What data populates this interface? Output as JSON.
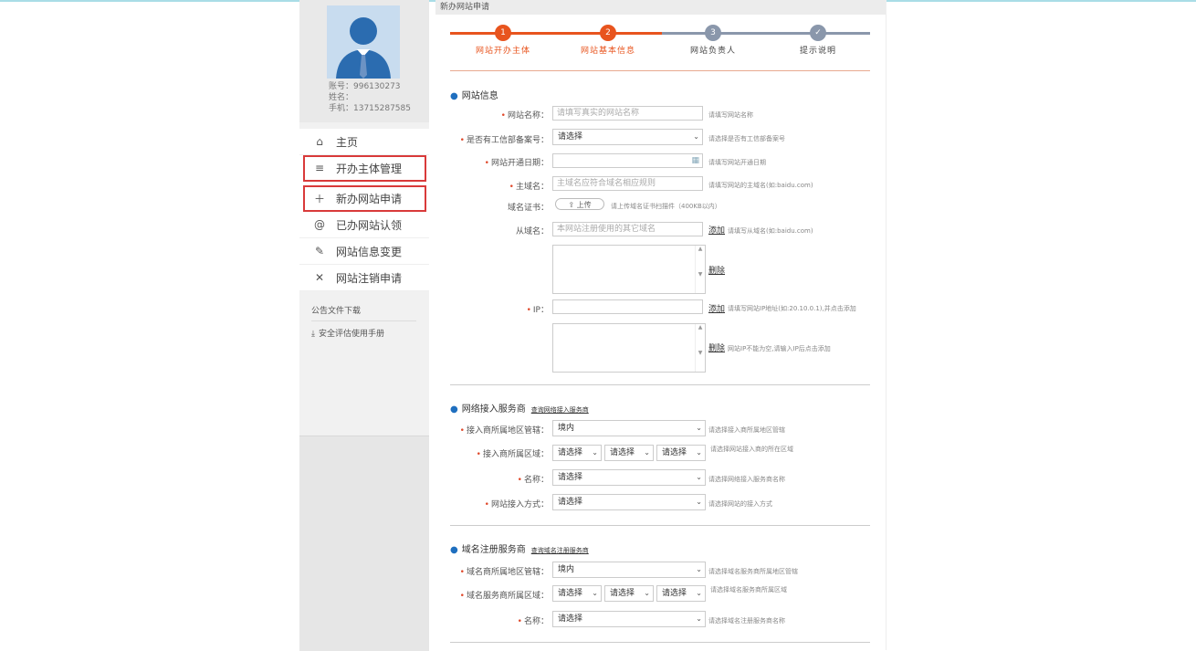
{
  "profile": {
    "account": "账号：996130273",
    "name": "姓名：",
    "phone": "手机：13715287585"
  },
  "menu": [
    {
      "icon": "home-icon",
      "label": "主页"
    },
    {
      "icon": "list-icon",
      "label": "开办主体管理"
    },
    {
      "icon": "plus-icon",
      "label": "新办网站申请"
    },
    {
      "icon": "at-icon",
      "label": "已办网站认领"
    },
    {
      "icon": "edit-icon",
      "label": "网站信息变更"
    },
    {
      "icon": "close-icon",
      "label": "网站注销申请"
    }
  ],
  "downloads": {
    "title": "公告文件下载",
    "item": "安全评估使用手册"
  },
  "breadcrumb": "新办网站申请",
  "steps": [
    {
      "num": "1",
      "label": "网站开办主体"
    },
    {
      "num": "2",
      "label": "网站基本信息"
    },
    {
      "num": "3",
      "label": "网站负责人"
    },
    {
      "num": "✓",
      "label": "提示说明"
    }
  ],
  "colors": {
    "active": "#e8541e",
    "inactive": "#8a97ab",
    "link": "#1f6fbf"
  },
  "site_info": {
    "title": "网站信息",
    "name_label": "网站名称：",
    "name_placeholder": "请填写真实的网站名称",
    "name_hint": "请填写网站名称",
    "icp_label": "是否有工信部备案号：",
    "icp_value": "请选择",
    "icp_hint": "请选择是否有工信部备案号",
    "open_date_label": "网站开通日期：",
    "open_date_hint": "请填写网站开通日期",
    "domain_label": "主域名：",
    "domain_placeholder": "主域名应符合域名相应规则",
    "domain_hint": "请填写网站的主域名(如:baidu.com)",
    "cert_label": "域名证书：",
    "upload_label": "上传",
    "cert_hint": "请上传域名证书扫描件（400KB以内）",
    "sub_label": "从域名：",
    "sub_placeholder": "本网站注册使用的其它域名",
    "add_label": "添加",
    "sub_hint": "请填写从域名(如:baidu.com)",
    "delete_label": "删除",
    "ip_label": "IP：",
    "ip_add": "添加",
    "ip_hint": "请填写网站IP地址(如:20.10.0.1),并点击添加",
    "ip_delete": "删除",
    "ip_delete_hint": "网站IP不能为空,请输入IP后点击添加"
  },
  "access": {
    "title": "网络接入服务商",
    "query": "查询网络接入服务商",
    "region_label": "接入商所属地区管辖：",
    "region_value": "境内",
    "region_hint": "请选择接入商所属地区管辖",
    "area_label": "接入商所属区域：",
    "area_values": [
      "请选择",
      "请选择",
      "请选择"
    ],
    "area_hint": "请选择网站接入商的所在区域",
    "name_label": "名称：",
    "name_value": "请选择",
    "name_hint": "请选择网络接入服务商名称",
    "mode_label": "网站接入方式：",
    "mode_value": "请选择",
    "mode_hint": "请选择网站的接入方式"
  },
  "registrar": {
    "title": "域名注册服务商",
    "query": "查询域名注册服务商",
    "region_label": "域名商所属地区管辖：",
    "region_value": "境内",
    "region_hint": "请选择域名服务商所属地区管辖",
    "area_label": "域名服务商所属区域：",
    "area_values": [
      "请选择",
      "请选择",
      "请选择"
    ],
    "area_hint": "请选择域名服务商所属区域",
    "name_label": "名称：",
    "name_value": "请选择",
    "name_hint": "请选择域名注册服务商名称"
  }
}
